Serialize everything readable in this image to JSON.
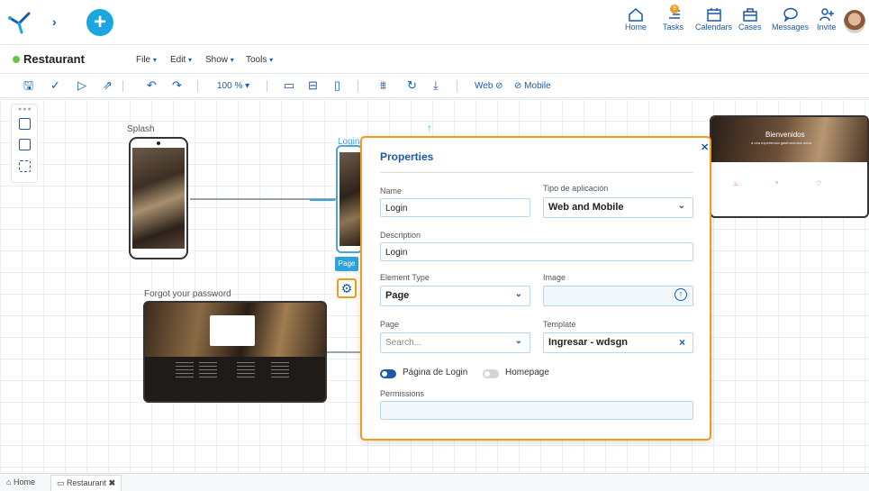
{
  "topnav": {
    "items": [
      {
        "label": "Home",
        "icon": "home-icon"
      },
      {
        "label": "Tasks",
        "icon": "tasks-icon",
        "badge": "9"
      },
      {
        "label": "Calendars",
        "icon": "calendar-icon"
      },
      {
        "label": "Cases",
        "icon": "briefcase-icon"
      },
      {
        "label": "Messages",
        "icon": "message-icon"
      },
      {
        "label": "Invite",
        "icon": "invite-icon"
      }
    ]
  },
  "project": {
    "name": "Restaurant",
    "menus": [
      "File",
      "Edit",
      "Show",
      "Tools"
    ]
  },
  "toolbar": {
    "zoom": "100 %",
    "web_label": "Web",
    "mobile_label": "Mobile"
  },
  "canvas": {
    "splash_label": "Splash",
    "login_label": "Login",
    "forgot_label": "Forgot your password",
    "page_chip": "Page",
    "right_card_title": "Bienvenidos",
    "right_card_sub": "a una experiencia gastronómica única"
  },
  "panel": {
    "title": "Properties",
    "name_label": "Name",
    "name_value": "Login",
    "app_type_label": "Tipo de aplicación",
    "app_type_value": "Web and Mobile",
    "description_label": "Description",
    "description_value": "Login",
    "element_type_label": "Element Type",
    "element_type_value": "Page",
    "image_label": "Image",
    "page_label": "Page",
    "page_placeholder": "Search...",
    "template_label": "Template",
    "template_value": "Ingresar - wdsgn",
    "login_toggle_label": "Página de Login",
    "homepage_toggle_label": "Homepage",
    "permissions_label": "Permissions"
  },
  "bottom_tabs": [
    {
      "label": "Home"
    },
    {
      "label": "Restaurant"
    }
  ],
  "colors": {
    "accent": "#1a5aa8",
    "highlight": "#f29a1d",
    "primary_button": "#1aa7e0",
    "status": "#6cc24a"
  }
}
